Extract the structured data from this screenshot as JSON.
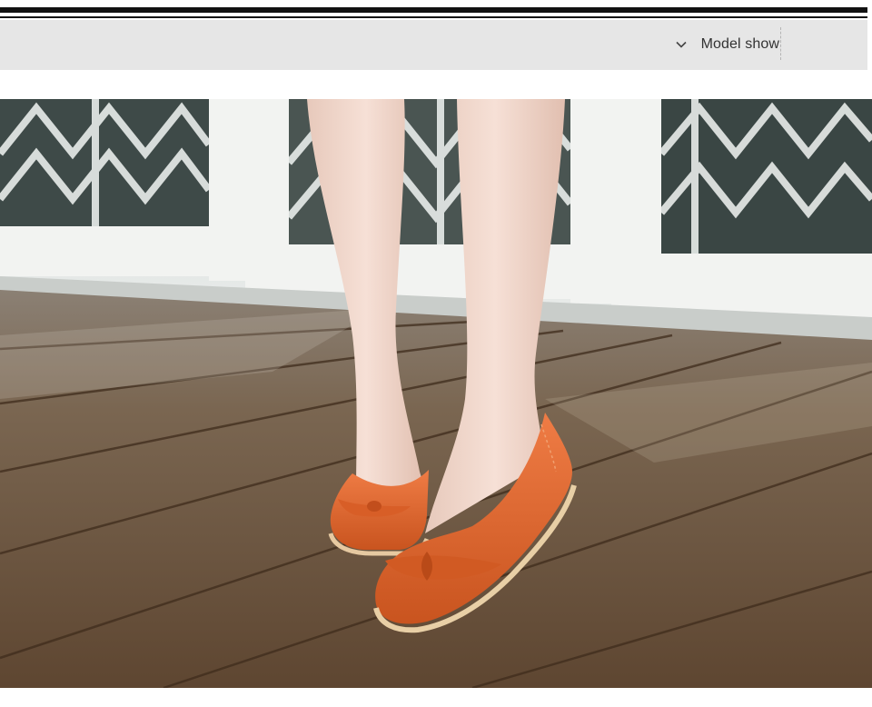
{
  "section_header": {
    "label": "Model show",
    "icon": "chevron-down-icon"
  },
  "product_photo": {
    "subject": "model-wearing-orange-leather-bow-ballet-flats",
    "shoe_color": "#e0682f"
  },
  "colors": {
    "header_background": "#e6e6e6",
    "rule": "#111111",
    "label_text": "#333333"
  }
}
